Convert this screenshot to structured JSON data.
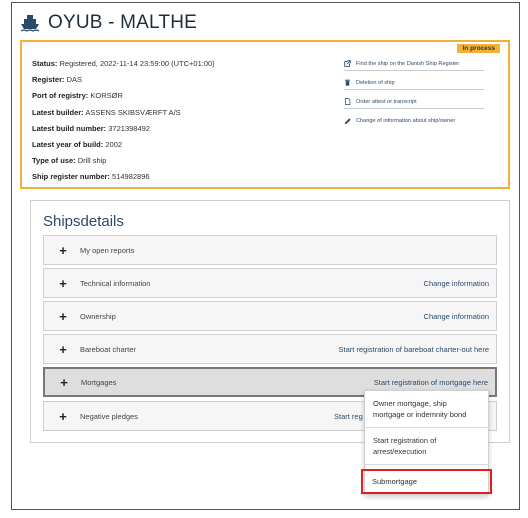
{
  "page": {
    "title": "OYUB - MALTHE"
  },
  "status_box": {
    "badge": "In process",
    "rows": [
      {
        "label": "Status:",
        "value": "Registered, 2022-11-14 23:59:00 (UTC+01:00)"
      },
      {
        "label": "Register:",
        "value": "DAS"
      },
      {
        "label": "Port of registry:",
        "value": "KORSØR"
      },
      {
        "label": "Latest builder:",
        "value": "ASSENS SKIBSVÆRFT A/S"
      },
      {
        "label": "Latest build number:",
        "value": "3721398492"
      },
      {
        "label": "Latest year of build:",
        "value": "2002"
      },
      {
        "label": "Type of use:",
        "value": "Drill ship"
      },
      {
        "label": "Ship register number:",
        "value": "514982896"
      }
    ],
    "actions": [
      {
        "label": "Find the ship on the Danish Ship Register",
        "icon": "external-link-icon"
      },
      {
        "label": "Deletion of ship",
        "icon": "trash-icon"
      },
      {
        "label": "Order attest or transcript",
        "icon": "document-icon"
      },
      {
        "label": "Change of information about ship/owner",
        "icon": "pencil-icon"
      }
    ]
  },
  "details": {
    "title": "Shipsdetails",
    "sections": [
      {
        "label": "My open reports",
        "link": ""
      },
      {
        "label": "Technical information",
        "link": "Change information"
      },
      {
        "label": "Ownership",
        "link": "Change information"
      },
      {
        "label": "Bareboat charter",
        "link": "Start registration of bareboat charter-out here"
      },
      {
        "label": "Mortgages",
        "link": "Start registration of mortgage here"
      },
      {
        "label": "Negative pledges",
        "link": "Start reg"
      }
    ]
  },
  "dropdown": {
    "items": [
      "Owner mortgage, ship mortgage or indemnity bond",
      "Start registration of arrest/execution",
      "Submortgage"
    ]
  }
}
